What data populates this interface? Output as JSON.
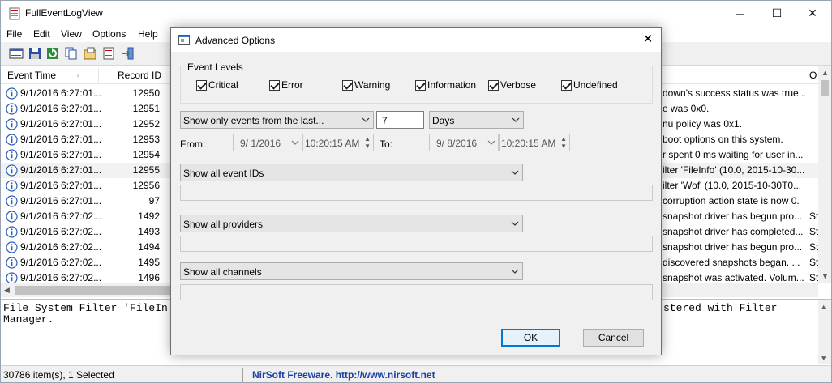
{
  "app": {
    "title": "FullEventLogView"
  },
  "menu": [
    "File",
    "Edit",
    "View",
    "Options",
    "Help"
  ],
  "columns": {
    "event_time": "Event Time",
    "record_id": "Record ID",
    "other": "O"
  },
  "rows": [
    {
      "time": "9/1/2016 6:27:01...",
      "id": "12950",
      "desc": "down's success status was true...",
      "extra": ""
    },
    {
      "time": "9/1/2016 6:27:01...",
      "id": "12951",
      "desc": "e was 0x0.",
      "extra": ""
    },
    {
      "time": "9/1/2016 6:27:01...",
      "id": "12952",
      "desc": "nu policy was 0x1.",
      "extra": ""
    },
    {
      "time": "9/1/2016 6:27:01...",
      "id": "12953",
      "desc": " boot options on this system.",
      "extra": ""
    },
    {
      "time": "9/1/2016 6:27:01...",
      "id": "12954",
      "desc": "r spent 0 ms waiting for user in...",
      "extra": ""
    },
    {
      "time": "9/1/2016 6:27:01...",
      "id": "12955",
      "desc": "ilter 'FileInfo' (10.0, 2015-10-30...",
      "extra": ""
    },
    {
      "time": "9/1/2016 6:27:01...",
      "id": "12956",
      "desc": "ilter 'Wof' (10.0, 2015-10-30T0...",
      "extra": ""
    },
    {
      "time": "9/1/2016 6:27:01...",
      "id": "97",
      "desc": "corruption action state is now 0.",
      "extra": ""
    },
    {
      "time": "9/1/2016 6:27:02...",
      "id": "1492",
      "desc": "snapshot driver has begun pro...",
      "extra": "St"
    },
    {
      "time": "9/1/2016 6:27:02...",
      "id": "1493",
      "desc": "snapshot driver has completed...",
      "extra": "St"
    },
    {
      "time": "9/1/2016 6:27:02...",
      "id": "1494",
      "desc": "snapshot driver has begun pro...",
      "extra": "St"
    },
    {
      "time": "9/1/2016 6:27:02...",
      "id": "1495",
      "desc": " discovered snapshots began. ...",
      "extra": "St"
    },
    {
      "time": "9/1/2016 6:27:02...",
      "id": "1496",
      "desc": "snapshot was activated. Volum...",
      "extra": "St"
    }
  ],
  "detail": {
    "line1": "File System Filter 'FileIn",
    "line2": "Manager.",
    "line1_right": "stered with Filter"
  },
  "status": {
    "count": "30786 item(s), 1 Selected",
    "credit": "NirSoft Freeware.  http://www.nirsoft.net"
  },
  "dialog": {
    "title": "Advanced Options",
    "event_levels_label": "Event Levels",
    "levels": [
      {
        "label": "Critical",
        "checked": true
      },
      {
        "label": "Error",
        "checked": true
      },
      {
        "label": "Warning",
        "checked": true
      },
      {
        "label": "Information",
        "checked": true
      },
      {
        "label": "Verbose",
        "checked": true
      },
      {
        "label": "Undefined",
        "checked": true
      }
    ],
    "time_filter": "Show only events from the last...",
    "time_value": "7",
    "time_unit": "Days",
    "from_label": "From:",
    "from_date": "9/  1/2016",
    "from_time": "10:20:15 AM",
    "to_label": "To:",
    "to_date": "9/  8/2016",
    "to_time": "10:20:15 AM",
    "event_ids_filter": "Show all event IDs",
    "providers_filter": "Show all providers",
    "channels_filter": "Show all channels",
    "ok_label": "OK",
    "cancel_label": "Cancel"
  },
  "colors": {
    "accent": "#0078d7",
    "link": "#1a3fa3"
  }
}
